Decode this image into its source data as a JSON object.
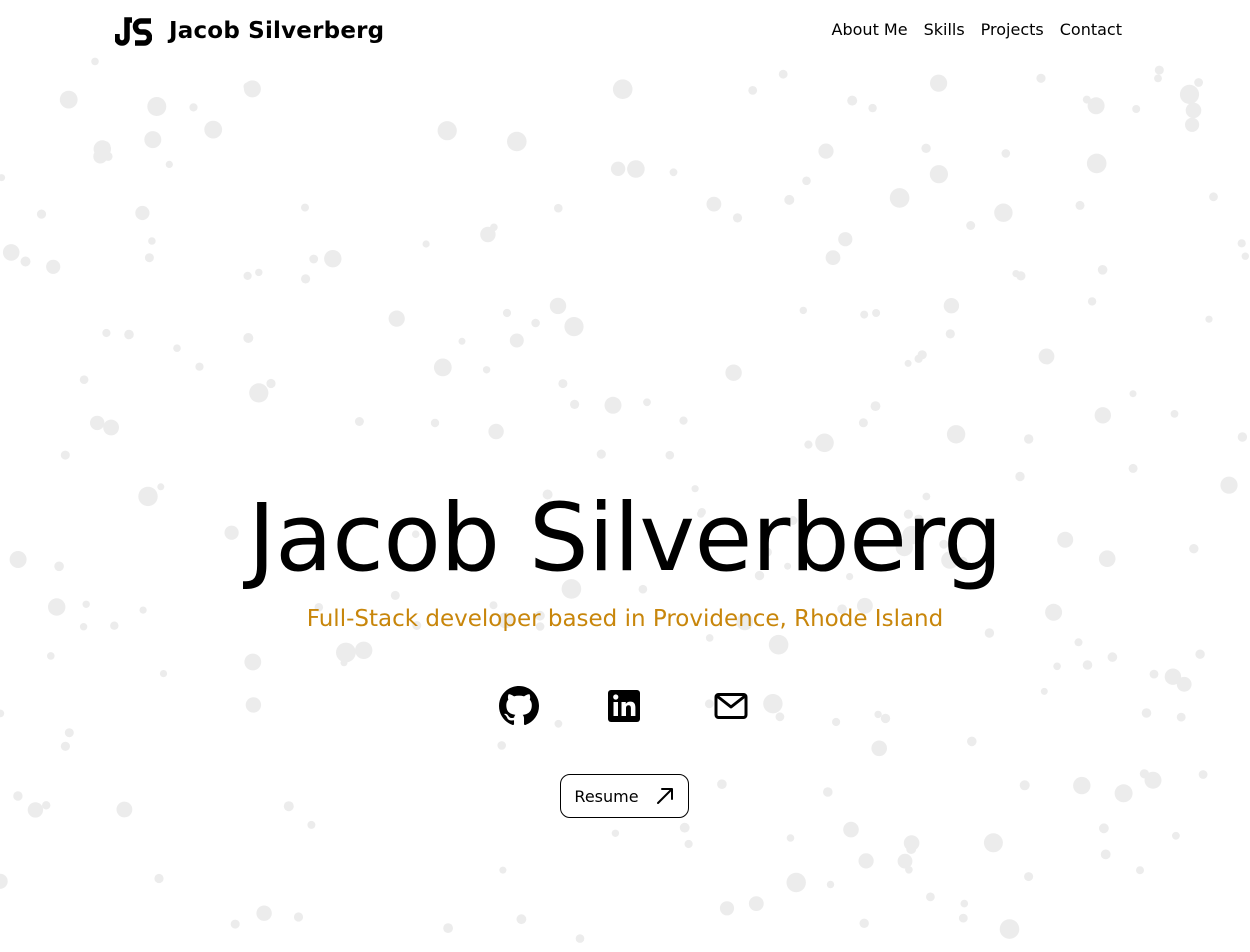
{
  "header": {
    "brand_name": "Jacob Silverberg",
    "logo_text": "JS",
    "nav": [
      {
        "label": "About Me"
      },
      {
        "label": "Skills"
      },
      {
        "label": "Projects"
      },
      {
        "label": "Contact"
      }
    ]
  },
  "hero": {
    "title": "Jacob Silverberg",
    "subtitle": "Full-Stack developer based in Providence, Rhode Island",
    "social": [
      {
        "icon": "github-icon"
      },
      {
        "icon": "linkedin-icon"
      },
      {
        "icon": "mail-icon"
      }
    ],
    "resume_label": "Resume",
    "resume_icon": "arrow-up-right-icon"
  },
  "colors": {
    "accent": "#c8860b",
    "text": "#000000",
    "background": "#ffffff",
    "particles": "#ececec"
  }
}
